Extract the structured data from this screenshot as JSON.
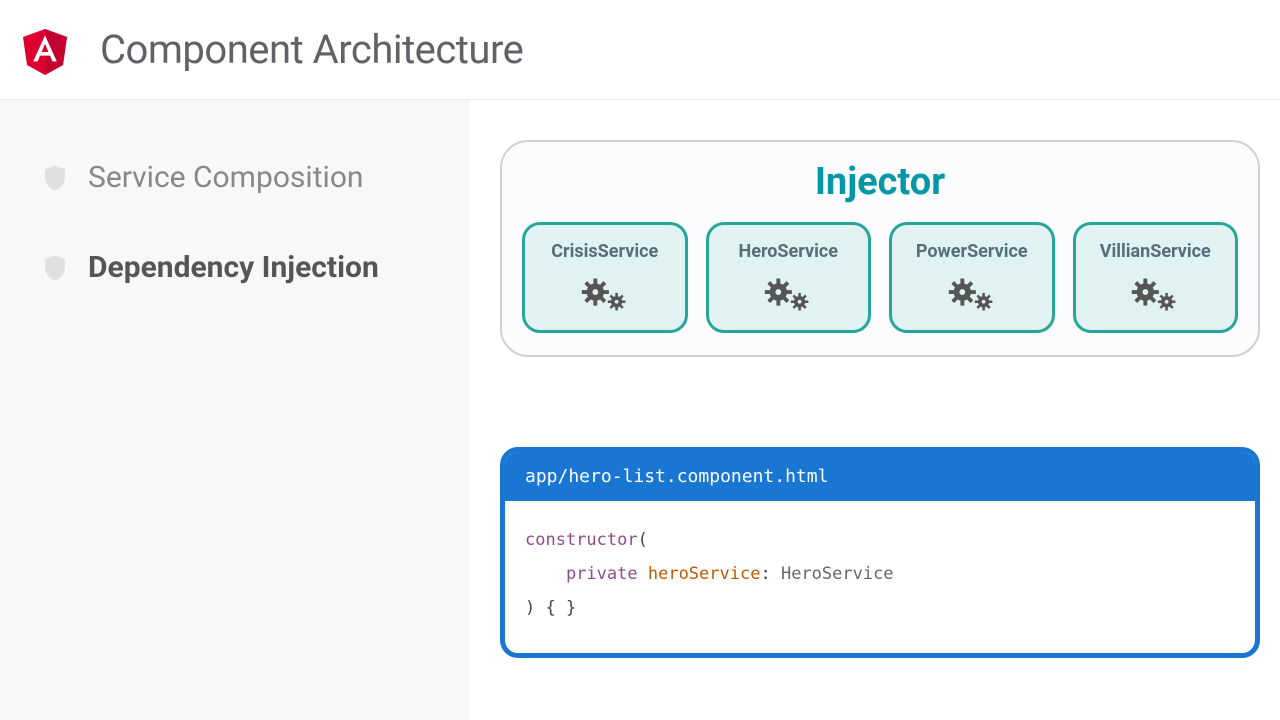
{
  "header": {
    "title": "Component Architecture"
  },
  "sidebar": {
    "items": [
      {
        "label": "Service Composition",
        "active": false
      },
      {
        "label": "Dependency Injection",
        "active": true
      }
    ]
  },
  "injector": {
    "title": "Injector",
    "services": [
      {
        "name": "CrisisService"
      },
      {
        "name": "HeroService"
      },
      {
        "name": "PowerService"
      },
      {
        "name": "VillianService"
      }
    ]
  },
  "code": {
    "filename": "app/hero-list.component.html",
    "kw_constructor": "constructor",
    "paren_open": "(",
    "kw_private": "private",
    "ident": "heroService",
    "colon": ":",
    "type": "HeroService",
    "close": ") { }"
  }
}
